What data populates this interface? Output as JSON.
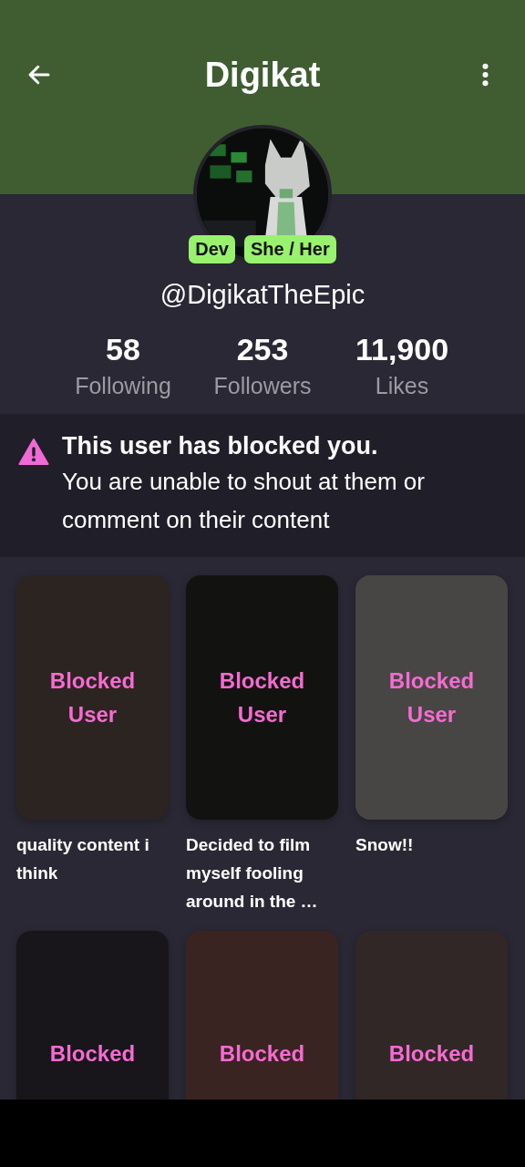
{
  "header": {
    "title": "Digikat"
  },
  "profile": {
    "badges": [
      {
        "label": "Dev"
      },
      {
        "label": "She / Her"
      }
    ],
    "handle": "@DigikatTheEpic"
  },
  "stats": [
    {
      "value": "58",
      "label": "Following"
    },
    {
      "value": "253",
      "label": "Followers"
    },
    {
      "value": "11,900",
      "label": "Likes"
    }
  ],
  "notice": {
    "title": "This user has blocked you.",
    "message": "You are unable to shout at them or comment on their content"
  },
  "posts": [
    {
      "label": "Blocked User",
      "caption": "quality content i think",
      "color": "#2c2420"
    },
    {
      "label": "Blocked User",
      "caption": "Decided to film myself fooling around in the …",
      "color": "#121311"
    },
    {
      "label": "Blocked User",
      "caption": "Snow!!",
      "color": "#474645"
    },
    {
      "label": "Blocked",
      "color": "#18161b"
    },
    {
      "label": "Blocked",
      "color": "#3a2422"
    },
    {
      "label": "Blocked",
      "color": "#312726"
    }
  ]
}
